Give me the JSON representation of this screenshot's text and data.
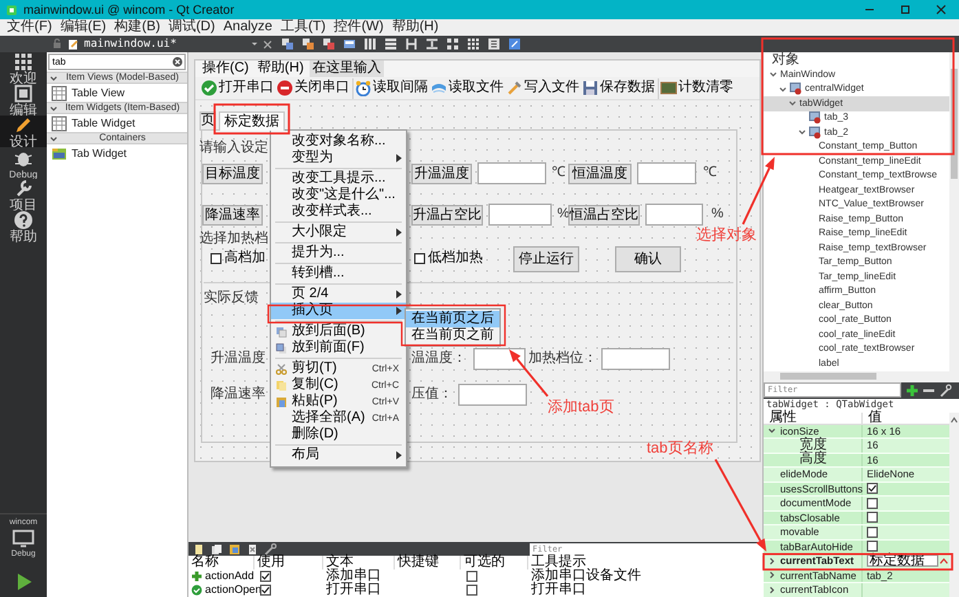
{
  "window": {
    "title": "mainwindow.ui @ wincom - Qt Creator"
  },
  "menu_bar": [
    "文件(F)",
    "编辑(E)",
    "构建(B)",
    "调试(D)",
    "Analyze",
    "工具(T)",
    "控件(W)",
    "帮助(H)"
  ],
  "editor": {
    "file": "mainwindow.ui*"
  },
  "mode_bar": {
    "items": [
      {
        "label": "欢迎",
        "selected": false
      },
      {
        "label": "编辑",
        "selected": false
      },
      {
        "label": "设计",
        "selected": true
      },
      {
        "label": "Debug",
        "selected": false
      },
      {
        "label": "项目",
        "selected": false
      },
      {
        "label": "帮助",
        "selected": false
      }
    ],
    "project": "wincom",
    "build_mode": "Debug"
  },
  "widget_box": {
    "search": "tab",
    "groups": [
      {
        "title": "Item Views (Model-Based)",
        "expanded": true,
        "items": [
          "Table View"
        ]
      },
      {
        "title": "Item Widgets (Item-Based)",
        "expanded": true,
        "items": [
          "Table Widget"
        ]
      },
      {
        "title": "Containers",
        "expanded": true,
        "items": [
          "Tab Widget"
        ]
      }
    ]
  },
  "form": {
    "menu": [
      "操作(C)",
      "帮助(H)",
      "在这里输入"
    ],
    "toolbar": [
      "打开串口",
      "关闭串口",
      "读取间隔",
      "读取文件",
      "写入文件",
      "保存数据",
      "计数清零"
    ],
    "tabs": [
      {
        "label": "页",
        "selected": false
      },
      {
        "label": "标定数据",
        "selected": true
      }
    ],
    "widgets": [
      {
        "kind": "heading",
        "text": "请输入设定"
      },
      {
        "kind": "button",
        "text": "目标温度"
      },
      {
        "kind": "button",
        "text": "升温温度"
      },
      {
        "kind": "field"
      },
      {
        "kind": "label",
        "text": "℃"
      },
      {
        "kind": "button",
        "text": "恒温温度"
      },
      {
        "kind": "field"
      },
      {
        "kind": "label",
        "text": "℃"
      },
      {
        "kind": "button",
        "text": "降温速率"
      },
      {
        "kind": "button",
        "text": "升温占空比"
      },
      {
        "kind": "field"
      },
      {
        "kind": "label",
        "text": "%"
      },
      {
        "kind": "button",
        "text": "恒温占空比"
      },
      {
        "kind": "field"
      },
      {
        "kind": "label",
        "text": "%"
      },
      {
        "kind": "heading",
        "text": "选择加热档"
      },
      {
        "kind": "checkbox",
        "text": "高档加",
        "checked": false
      },
      {
        "kind": "checkbox",
        "text": "低档加热",
        "checked": false
      },
      {
        "kind": "button",
        "text": "停止运行"
      },
      {
        "kind": "button",
        "text": "确认"
      },
      {
        "kind": "heading",
        "text": "实际反馈"
      },
      {
        "kind": "label",
        "text": "升温温度"
      },
      {
        "kind": "label",
        "text": "温温度："
      },
      {
        "kind": "field"
      },
      {
        "kind": "label",
        "text": "加热档位："
      },
      {
        "kind": "field"
      },
      {
        "kind": "label",
        "text": "降温速率"
      },
      {
        "kind": "label",
        "text": "压值："
      },
      {
        "kind": "field"
      }
    ]
  },
  "context_menu": {
    "items": [
      {
        "kind": "item",
        "label": "改变对象名称...",
        "selected": false
      },
      {
        "kind": "item",
        "label": "变型为",
        "submenu": true,
        "selected": false
      },
      {
        "kind": "separator"
      },
      {
        "kind": "item",
        "label": "改变工具提示...",
        "selected": false
      },
      {
        "kind": "item",
        "label": "改变\"这是什么\"...",
        "selected": false
      },
      {
        "kind": "item",
        "label": "改变样式表...",
        "selected": false
      },
      {
        "kind": "separator"
      },
      {
        "kind": "item",
        "label": "大小限定",
        "submenu": true,
        "selected": false
      },
      {
        "kind": "separator"
      },
      {
        "kind": "item",
        "label": "提升为...",
        "selected": false
      },
      {
        "kind": "separator"
      },
      {
        "kind": "item",
        "label": "转到槽...",
        "selected": false
      },
      {
        "kind": "separator"
      },
      {
        "kind": "item",
        "label": "页 2/4",
        "submenu": true,
        "selected": false
      },
      {
        "kind": "item",
        "label": "插入页",
        "submenu": true,
        "selected": true
      },
      {
        "kind": "separator"
      },
      {
        "kind": "item",
        "label": "放到后面(B)",
        "selected": false
      },
      {
        "kind": "item",
        "label": "放到前面(F)",
        "selected": false
      },
      {
        "kind": "separator"
      },
      {
        "kind": "item",
        "label": "剪切(T)",
        "shortcut": "Ctrl+X",
        "selected": false
      },
      {
        "kind": "item",
        "label": "复制(C)",
        "shortcut": "Ctrl+C",
        "selected": false
      },
      {
        "kind": "item",
        "label": "粘贴(P)",
        "shortcut": "Ctrl+V",
        "selected": false
      },
      {
        "kind": "item",
        "label": "选择全部(A)",
        "shortcut": "Ctrl+A",
        "selected": false
      },
      {
        "kind": "item",
        "label": "删除(D)",
        "selected": false
      },
      {
        "kind": "separator"
      },
      {
        "kind": "item",
        "label": "布局",
        "submenu": true,
        "selected": false
      }
    ]
  },
  "submenu": {
    "items": [
      {
        "label": "在当前页之后",
        "selected": true
      },
      {
        "label": "在当前页之前",
        "selected": false
      }
    ]
  },
  "object_inspector": {
    "header": "对象",
    "tree": [
      {
        "name": "MainWindow",
        "selected": false,
        "expanded": true,
        "children": [
          {
            "name": "centralWidget",
            "selected": false,
            "expanded": true,
            "children": [
              {
                "name": "tabWidget",
                "selected": true,
                "expanded": true,
                "children": [
                  {
                    "name": "tab_3",
                    "selected": false
                  },
                  {
                    "name": "tab_2",
                    "selected": false,
                    "expanded": true,
                    "children": [
                      {
                        "name": "Constant_temp_Button",
                        "selected": false
                      },
                      {
                        "name": "Constant_temp_lineEdit",
                        "selected": false
                      },
                      {
                        "name": "Constant_temp_textBrowse",
                        "selected": false
                      },
                      {
                        "name": "Heatgear_textBrowser",
                        "selected": false
                      },
                      {
                        "name": "NTC_Value_textBrowser",
                        "selected": false
                      },
                      {
                        "name": "Raise_temp_Button",
                        "selected": false
                      },
                      {
                        "name": "Raise_temp_lineEdit",
                        "selected": false
                      },
                      {
                        "name": "Raise_temp_textBrowser",
                        "selected": false
                      },
                      {
                        "name": "Tar_temp_Button",
                        "selected": false
                      },
                      {
                        "name": "Tar_temp_lineEdit",
                        "selected": false
                      },
                      {
                        "name": "affirm_Button",
                        "selected": false
                      },
                      {
                        "name": "clear_Button",
                        "selected": false
                      },
                      {
                        "name": "cool_rate_Button",
                        "selected": false
                      },
                      {
                        "name": "cool_rate_lineEdit",
                        "selected": false
                      },
                      {
                        "name": "cool_rate_textBrowser",
                        "selected": false
                      },
                      {
                        "name": "label",
                        "selected": false
                      }
                    ]
                  }
                ]
              }
            ]
          }
        ]
      }
    ]
  },
  "property_editor": {
    "filter_placeholder": "Filter",
    "object": "tabWidget : QTabWidget",
    "columns": [
      "属性",
      "值"
    ],
    "properties": [
      {
        "kind": "text",
        "name": "iconSize",
        "value": "16 x 16",
        "expanded": true,
        "children": [
          {
            "kind": "text",
            "name": "宽度",
            "value": "16"
          },
          {
            "kind": "text",
            "name": "高度",
            "value": "16"
          }
        ]
      },
      {
        "kind": "text",
        "name": "elideMode",
        "value": "ElideNone"
      },
      {
        "kind": "check",
        "name": "usesScrollButtons",
        "checked": true
      },
      {
        "kind": "check",
        "name": "documentMode",
        "checked": false
      },
      {
        "kind": "check",
        "name": "tabsClosable",
        "checked": false
      },
      {
        "kind": "check",
        "name": "movable",
        "checked": false
      },
      {
        "kind": "check",
        "name": "tabBarAutoHide",
        "checked": false
      },
      {
        "kind": "edit",
        "name": "currentTabText",
        "value": "标定数据",
        "expanded": false
      },
      {
        "kind": "text",
        "name": "currentTabName",
        "value": "tab_2",
        "expanded": false
      },
      {
        "kind": "text",
        "name": "currentTabIcon",
        "expanded": false
      }
    ]
  },
  "action_editor": {
    "filter_placeholder": "Filter",
    "columns": [
      "名称",
      "使用",
      "文本",
      "快捷键",
      "可选的",
      "工具提示"
    ],
    "rows": [
      {
        "name": "actionAdd",
        "used": true,
        "text": "添加串口",
        "checkable": false,
        "tooltip": "添加串口设备文件"
      },
      {
        "name": "actionOpen",
        "used": true,
        "text": "打开串口",
        "checkable": false,
        "tooltip": "打开串口"
      }
    ]
  },
  "annotations": [
    "选择对象",
    "添加tab页",
    "tab页名称"
  ]
}
